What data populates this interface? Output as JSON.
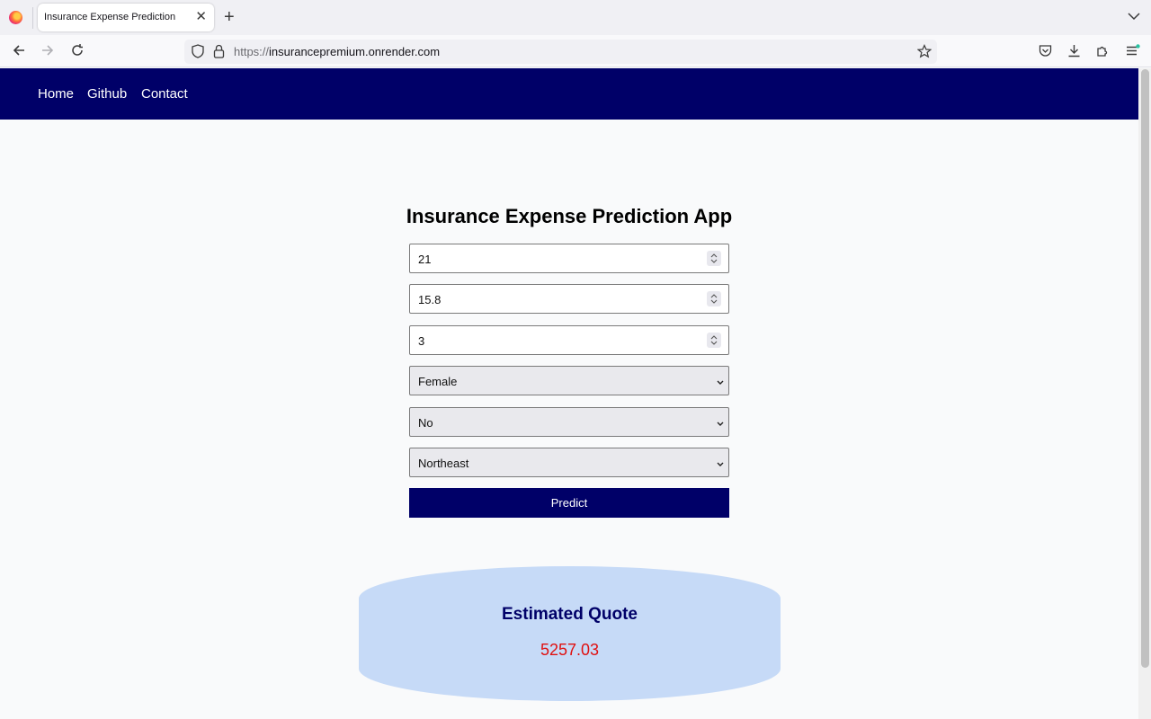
{
  "browser": {
    "tab_title": "Insurance Expense Prediction",
    "url_scheme": "https://",
    "url_host": "insurancepremium.onrender.com"
  },
  "site_nav": {
    "links": [
      "Home",
      "Github",
      "Contact"
    ]
  },
  "form": {
    "title": "Insurance Expense Prediction App",
    "age": "21",
    "bmi": "15.8",
    "children": "3",
    "sex": "Female",
    "smoker": "No",
    "region": "Northeast",
    "submit_label": "Predict"
  },
  "result": {
    "title": "Estimated Quote",
    "value": "5257.03"
  },
  "colors": {
    "nav_bg": "#000068",
    "card_bg": "#c6daf7",
    "quote_value": "#e01010"
  }
}
